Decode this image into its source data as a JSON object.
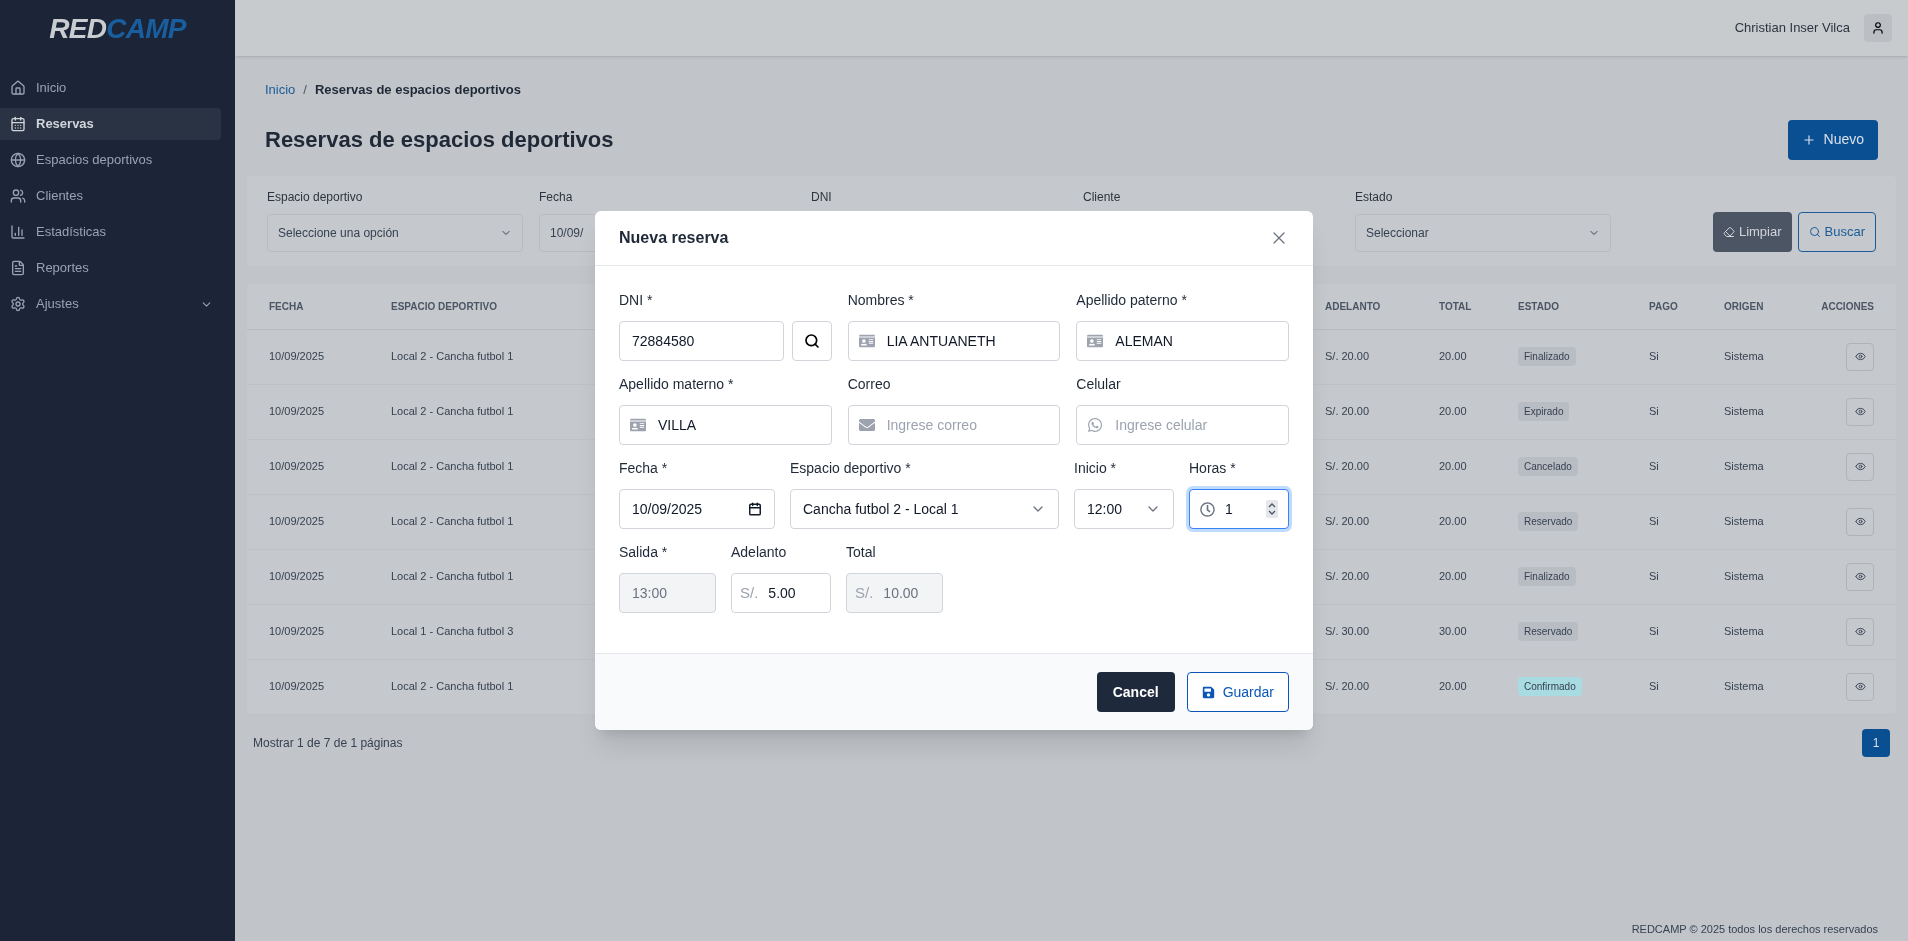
{
  "logo": {
    "parts": [
      "RED",
      "CAMP"
    ]
  },
  "sidebar": {
    "items": [
      {
        "label": "Inicio",
        "selected": false,
        "kind": "link"
      },
      {
        "label": "Reservas",
        "selected": true,
        "kind": "link"
      },
      {
        "label": "Espacios deportivos",
        "selected": false,
        "kind": "link"
      },
      {
        "label": "Clientes",
        "selected": false,
        "kind": "link"
      },
      {
        "label": "Estadísticas",
        "selected": false,
        "kind": "link"
      },
      {
        "label": "Reportes",
        "selected": false,
        "kind": "link"
      },
      {
        "label": "Ajustes",
        "selected": false,
        "kind": "group"
      }
    ]
  },
  "topbar": {
    "user": "Christian Inser Vilca"
  },
  "breadcrumb": {
    "items": [
      "Inicio",
      "Reservas de espacios deportivos"
    ],
    "separator": "/"
  },
  "page_title": "Reservas de espacios deportivos",
  "new_button": "Nuevo",
  "filters": [
    {
      "label": "Espacio deportivo",
      "placeholder": "Seleccione una opción",
      "kind": "select"
    },
    {
      "label": "Fecha",
      "value": "10/09/",
      "kind": "date"
    },
    {
      "label": "DNI",
      "kind": "hidden"
    },
    {
      "label": "Cliente",
      "kind": "hidden"
    },
    {
      "label": "Estado",
      "placeholder": "Seleccionar",
      "kind": "select"
    }
  ],
  "filter_buttons": {
    "clear": "Limpiar",
    "search": "Buscar"
  },
  "table": {
    "columns": [
      "FECHA",
      "ESPACIO DEPORTIVO",
      "ADELANTO",
      "TOTAL",
      "ESTADO",
      "PAGO",
      "ORIGEN",
      "ACCIONES"
    ],
    "rows": [
      {
        "fecha": "10/09/2025",
        "espacio": "Local 2 - Cancha futbol 1",
        "adelanto": "S/. 20.00",
        "total": "20.00",
        "estado": "Finalizado",
        "color": "#b8bdc3",
        "pago": "Si",
        "origen": "Sistema"
      },
      {
        "fecha": "10/09/2025",
        "espacio": "Local 2 - Cancha futbol 1",
        "adelanto": "S/. 20.00",
        "total": "20.00",
        "estado": "Expirado",
        "color": "#b8bdc3",
        "pago": "Si",
        "origen": "Sistema"
      },
      {
        "fecha": "10/09/2025",
        "espacio": "Local 2 - Cancha futbol 1",
        "adelanto": "S/. 20.00",
        "total": "20.00",
        "estado": "Cancelado",
        "color": "#b8bdc3",
        "pago": "Si",
        "origen": "Sistema"
      },
      {
        "fecha": "10/09/2025",
        "espacio": "Local 2 - Cancha futbol 1",
        "adelanto": "S/. 20.00",
        "total": "20.00",
        "estado": "Reservado",
        "color": "#b8bdc3",
        "pago": "Si",
        "origen": "Sistema"
      },
      {
        "fecha": "10/09/2025",
        "espacio": "Local 2 - Cancha futbol 1",
        "adelanto": "S/. 20.00",
        "total": "20.00",
        "estado": "Finalizado",
        "color": "#b8bdc3",
        "pago": "Si",
        "origen": "Sistema"
      },
      {
        "fecha": "10/09/2025",
        "espacio": "Local 1 - Cancha futbol 3",
        "adelanto": "S/. 30.00",
        "total": "30.00",
        "estado": "Reservado",
        "color": "#b8bdc3",
        "pago": "Si",
        "origen": "Sistema"
      },
      {
        "fecha": "10/09/2025",
        "espacio": "Local 2 - Cancha futbol 1",
        "adelanto": "S/. 20.00",
        "total": "20.00",
        "estado": "Confirmado",
        "color": "#a9dbe2",
        "pago": "Si",
        "origen": "Sistema"
      }
    ]
  },
  "pagination": {
    "summary": "Mostrar 1 de 7 de 1 páginas",
    "pages": [
      {
        "label": "1",
        "selected": true
      }
    ]
  },
  "footer": "REDCAMP © 2025 todos los derechos reservados",
  "modal": {
    "title": "Nueva reserva",
    "sections": [
      {
        "fields": [
          {
            "label": "DNI *",
            "value": "72884580",
            "kind": "dni",
            "disabled": false,
            "focused": false
          },
          {
            "label": "Nombres *",
            "value": "LIA ANTUANETH",
            "kind": "id",
            "disabled": false,
            "focused": false
          },
          {
            "label": "Apellido paterno *",
            "value": "ALEMAN",
            "kind": "id",
            "disabled": false,
            "focused": false
          }
        ]
      },
      {
        "fields": [
          {
            "label": "Apellido materno *",
            "value": "VILLA",
            "kind": "id",
            "disabled": false,
            "focused": false
          },
          {
            "label": "Correo",
            "placeholder": "Ingrese correo",
            "kind": "email",
            "disabled": false,
            "focused": false
          },
          {
            "label": "Celular",
            "placeholder": "Ingrese celular",
            "kind": "phone",
            "disabled": false,
            "focused": false
          }
        ]
      },
      {
        "fields": [
          {
            "label": "Fecha *",
            "value": "10/09/2025",
            "kind": "date",
            "disabled": false,
            "focused": false
          },
          {
            "label": "Espacio deportivo *",
            "value": "Cancha futbol 2 - Local 1",
            "kind": "select",
            "disabled": false,
            "focused": false
          },
          {
            "label": "Inicio *",
            "value": "12:00",
            "kind": "select",
            "disabled": false,
            "focused": false
          },
          {
            "label": "Horas *",
            "value": "1",
            "kind": "hours",
            "disabled": false,
            "focused": true
          }
        ]
      },
      {
        "fields": [
          {
            "label": "Salida *",
            "value": "13:00",
            "kind": "text",
            "disabled": true,
            "focused": false
          },
          {
            "label": "Adelanto",
            "prefix": "S/.",
            "value": "5.00",
            "kind": "money",
            "disabled": false,
            "focused": false
          },
          {
            "label": "Total",
            "prefix": "S/.",
            "value": "10.00",
            "kind": "money",
            "disabled": true,
            "focused": false
          }
        ]
      }
    ],
    "cancel": "Cancel",
    "save": "Guardar"
  }
}
